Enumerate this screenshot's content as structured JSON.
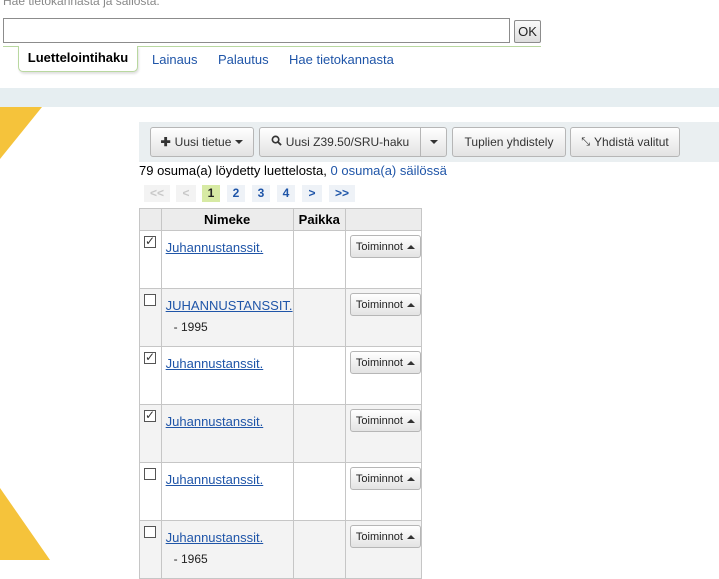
{
  "header": {
    "search_label": "Hae tietokannasta ja säilöstä:",
    "search_value": "",
    "ok_label": "OK",
    "tabs": [
      {
        "label": "Luettelointihaku",
        "active": true
      },
      {
        "label": "Lainaus",
        "active": false
      },
      {
        "label": "Palautus",
        "active": false
      },
      {
        "label": "Hae tietokannasta",
        "active": false
      }
    ]
  },
  "toolbar": {
    "new_record_label": "Uusi tietue",
    "z3950_label": "Uusi Z39.50/SRU-haku",
    "duplicates_label": "Tuplien yhdistely",
    "merge_label": "Yhdistä valitut"
  },
  "results": {
    "catalog_count_text": "79 osuma(a) löydetty luettelosta,",
    "reservoir_link": "0 osuma(a) säilössä"
  },
  "pager": {
    "first": "<<",
    "prev": "<",
    "pages": [
      "1",
      "2",
      "3",
      "4"
    ],
    "current": "1",
    "next": ">",
    "last": ">>"
  },
  "table": {
    "headers": [
      "",
      "Nimeke",
      "Paikka",
      ""
    ],
    "action_label": "Toiminnot",
    "rows": [
      {
        "checked": true,
        "title": "Juhannustanssit.",
        "date": "",
        "location": ""
      },
      {
        "checked": false,
        "title": "JUHANNUSTANSSIT.",
        "date": "- 1995",
        "location": ""
      },
      {
        "checked": true,
        "title": "Juhannustanssit.",
        "date": "",
        "location": ""
      },
      {
        "checked": true,
        "title": "Juhannustanssit.",
        "date": "",
        "location": ""
      },
      {
        "checked": false,
        "title": "Juhannustanssit.",
        "date": "",
        "location": ""
      },
      {
        "checked": false,
        "title": "Juhannustanssit.",
        "date": "- 1965",
        "location": ""
      }
    ]
  },
  "colors": {
    "link": "#1f55a8",
    "accent_yellow": "#f5c33b",
    "band_blue": "#e6eef1",
    "pager_current": "#d7eaa4"
  }
}
